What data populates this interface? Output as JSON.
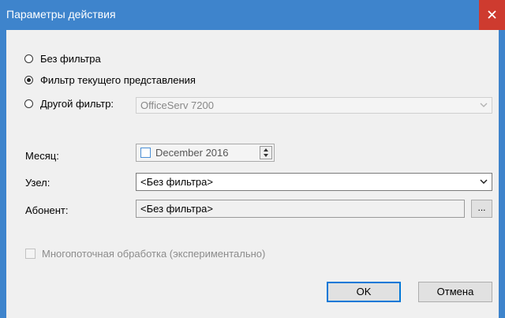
{
  "window": {
    "title": "Параметры действия",
    "close_glyph": "x",
    "accent_color": "#3e84cc",
    "close_color": "#ce3b2f"
  },
  "filter": {
    "options": [
      {
        "label": "Без фильтра",
        "checked": false
      },
      {
        "label": "Фильтр текущего представления",
        "checked": true
      },
      {
        "label": "Другой фильтр:",
        "checked": false
      }
    ],
    "other_filter_value": "OfficeServ 7200"
  },
  "fields": {
    "month_label": "Месяц:",
    "month_value": "December 2016",
    "node_label": "Узел:",
    "node_value": "<Без фильтра>",
    "subscriber_label": "Абонент:",
    "subscriber_value": "<Без фильтра>",
    "browse_label": "..."
  },
  "multithread": {
    "label": "Многопоточная обработка (экспериментально)",
    "checked": false,
    "enabled": false
  },
  "buttons": {
    "ok": "OK",
    "cancel": "Отмена"
  }
}
